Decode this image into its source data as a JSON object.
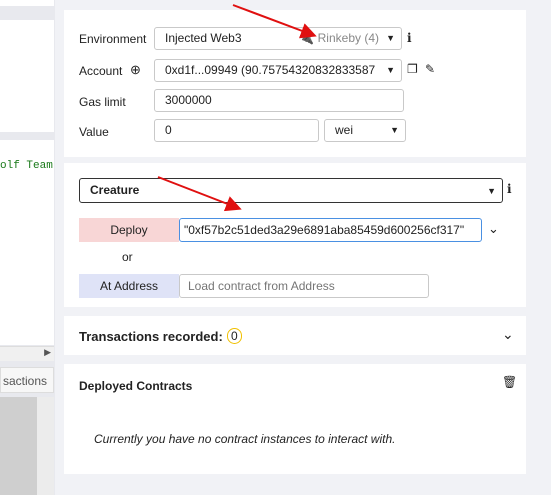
{
  "left_panel": {
    "code_snippet": "olf Team",
    "tab_label": "sactions"
  },
  "run_panel": {
    "environment": {
      "label": "Environment",
      "value": "Injected Web3",
      "network": "Rinkeby (4)"
    },
    "account": {
      "label": "Account",
      "value": "0xd1f...09949 (90.75754320832833587"
    },
    "gas_limit": {
      "label": "Gas limit",
      "value": "3000000"
    },
    "value": {
      "label": "Value",
      "amount": "0",
      "unit": "wei"
    }
  },
  "contract_panel": {
    "selected_contract": "Creature",
    "deploy_label": "Deploy",
    "deploy_args": "\"0xf57b2c51ded3a29e6891aba85459d600256cf317\"",
    "or_label": "or",
    "at_address_label": "At Address",
    "at_address_placeholder": "Load contract from Address"
  },
  "transactions": {
    "label": "Transactions recorded:",
    "count": "0"
  },
  "deployed": {
    "title": "Deployed Contracts",
    "empty_message": "Currently you have no contract instances to interact with."
  },
  "colors": {
    "deploy_button": "#f8d6d6",
    "at_address_button": "#dfe3f7",
    "annotation_arrow": "#e01010",
    "badge_border": "#f0c000"
  }
}
